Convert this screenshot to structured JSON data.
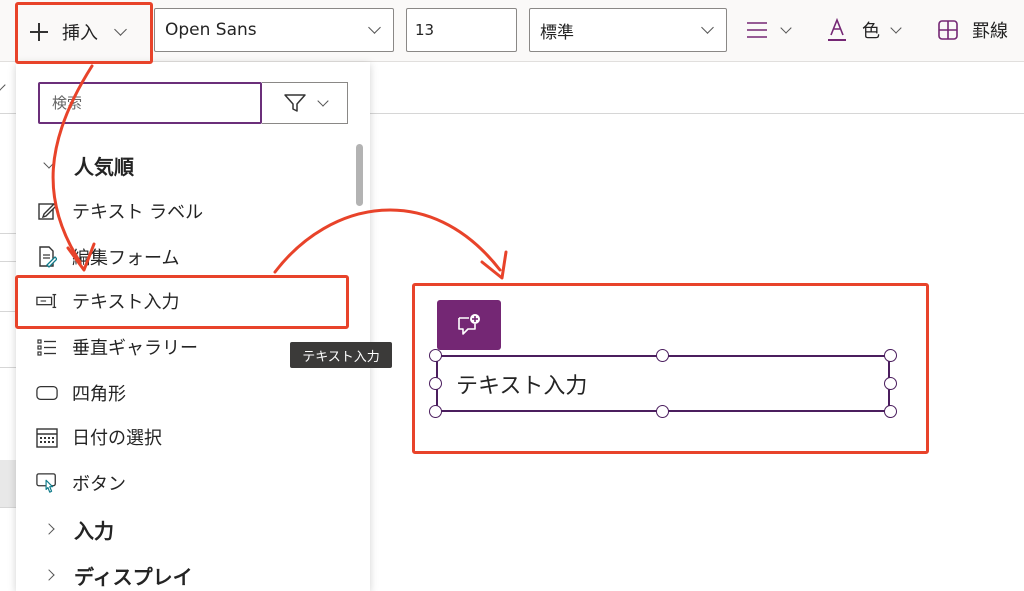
{
  "toolbar": {
    "insert_label": "挿入",
    "font_family": "Open Sans",
    "font_size": "13",
    "font_weight": "標準",
    "color_label": "色",
    "border_label": "罫線"
  },
  "panel": {
    "search_placeholder": "検索",
    "groups": {
      "popular": "人気順",
      "input": "入力",
      "display": "ディスプレイ"
    },
    "items": [
      {
        "label": "テキスト ラベル",
        "icon": "edit-label-icon"
      },
      {
        "label": "編集フォーム",
        "icon": "edit-form-icon"
      },
      {
        "label": "テキスト入力",
        "icon": "text-input-icon"
      },
      {
        "label": "垂直ギャラリー",
        "icon": "gallery-icon"
      },
      {
        "label": "四角形",
        "icon": "rectangle-icon"
      },
      {
        "label": "日付の選択",
        "icon": "calendar-icon"
      },
      {
        "label": "ボタン",
        "icon": "button-icon"
      }
    ]
  },
  "tooltip": "テキスト入力",
  "canvas": {
    "control_text": "テキスト入力"
  },
  "colors": {
    "accent": "#742774",
    "annotation": "#e8432a"
  }
}
